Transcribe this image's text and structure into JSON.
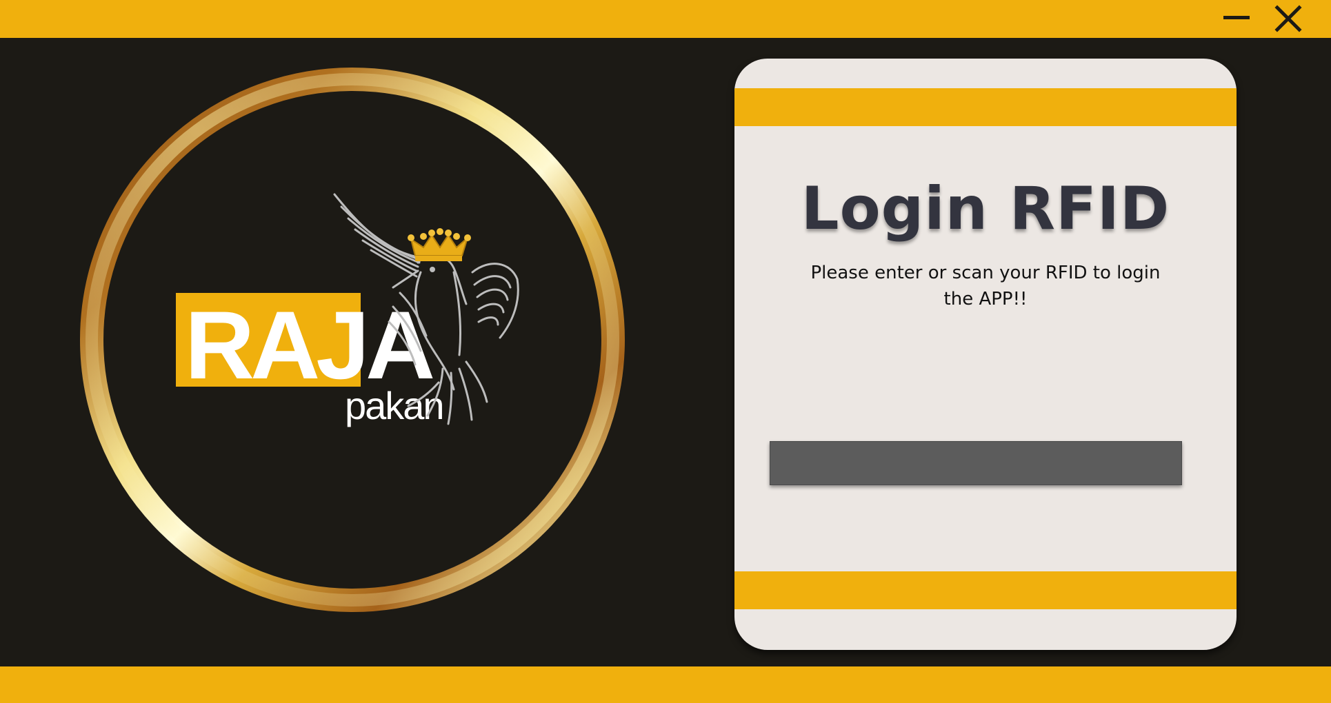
{
  "window": {
    "minimize_icon": "minimize-icon",
    "close_icon": "close-icon",
    "accent_color": "#f0b00d",
    "background_color": "#1c1a15"
  },
  "brand": {
    "name": "RAJA",
    "tagline": "pakan",
    "icons": [
      "hummingbird-icon",
      "crown-icon"
    ],
    "ring_color": "#c8892a"
  },
  "login": {
    "title": "Login RFID",
    "subtitle": "Please enter or scan your RFID to login the APP!!",
    "rfid_value": "",
    "rfid_placeholder": ""
  }
}
